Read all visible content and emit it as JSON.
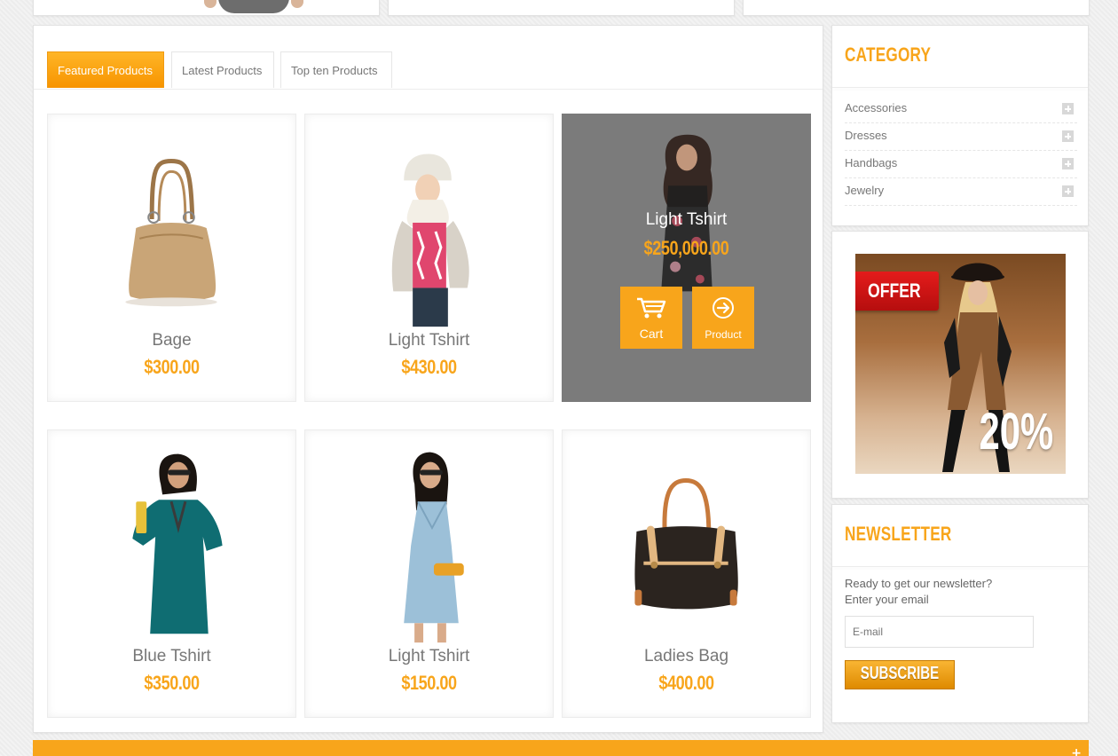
{
  "tabs": [
    {
      "label": "Featured Products",
      "active": true
    },
    {
      "label": "Latest Products",
      "active": false
    },
    {
      "label": "Top ten Products",
      "active": false
    }
  ],
  "products": [
    {
      "name": "Bage",
      "price": "$300.00",
      "image": "brown-handbag-image"
    },
    {
      "name": "Light Tshirt",
      "price": "$430.00",
      "image": "woman-beanie-sweater-image"
    },
    {
      "name": "Light Tshirt",
      "price": "$250,000.00",
      "image": "woman-floral-dress-image",
      "hovered": true
    },
    {
      "name": "Blue Tshirt",
      "price": "$350.00",
      "image": "woman-teal-dress-image"
    },
    {
      "name": "Light Tshirt",
      "price": "$150.00",
      "image": "woman-denim-dress-image"
    },
    {
      "name": "Ladies Bag",
      "price": "$400.00",
      "image": "black-leather-handbag-image"
    }
  ],
  "hover_actions": {
    "cart_label": "Cart",
    "product_label": "Product"
  },
  "category": {
    "title": "CATEGORY",
    "items": [
      "Accessories",
      "Dresses",
      "Handbags",
      "Jewelry"
    ]
  },
  "offer": {
    "tag": "OFFER",
    "percent": "20%"
  },
  "newsletter": {
    "title": "NEWSLETTER",
    "line1": "Ready to get our newsletter?",
    "line2": "Enter your email",
    "placeholder": "E-mail",
    "button_label": "SUBSCRIBE"
  },
  "colors": {
    "accent": "#f8a51b",
    "hover_overlay": "#7b7b7b",
    "offer_red": "#d51515"
  }
}
